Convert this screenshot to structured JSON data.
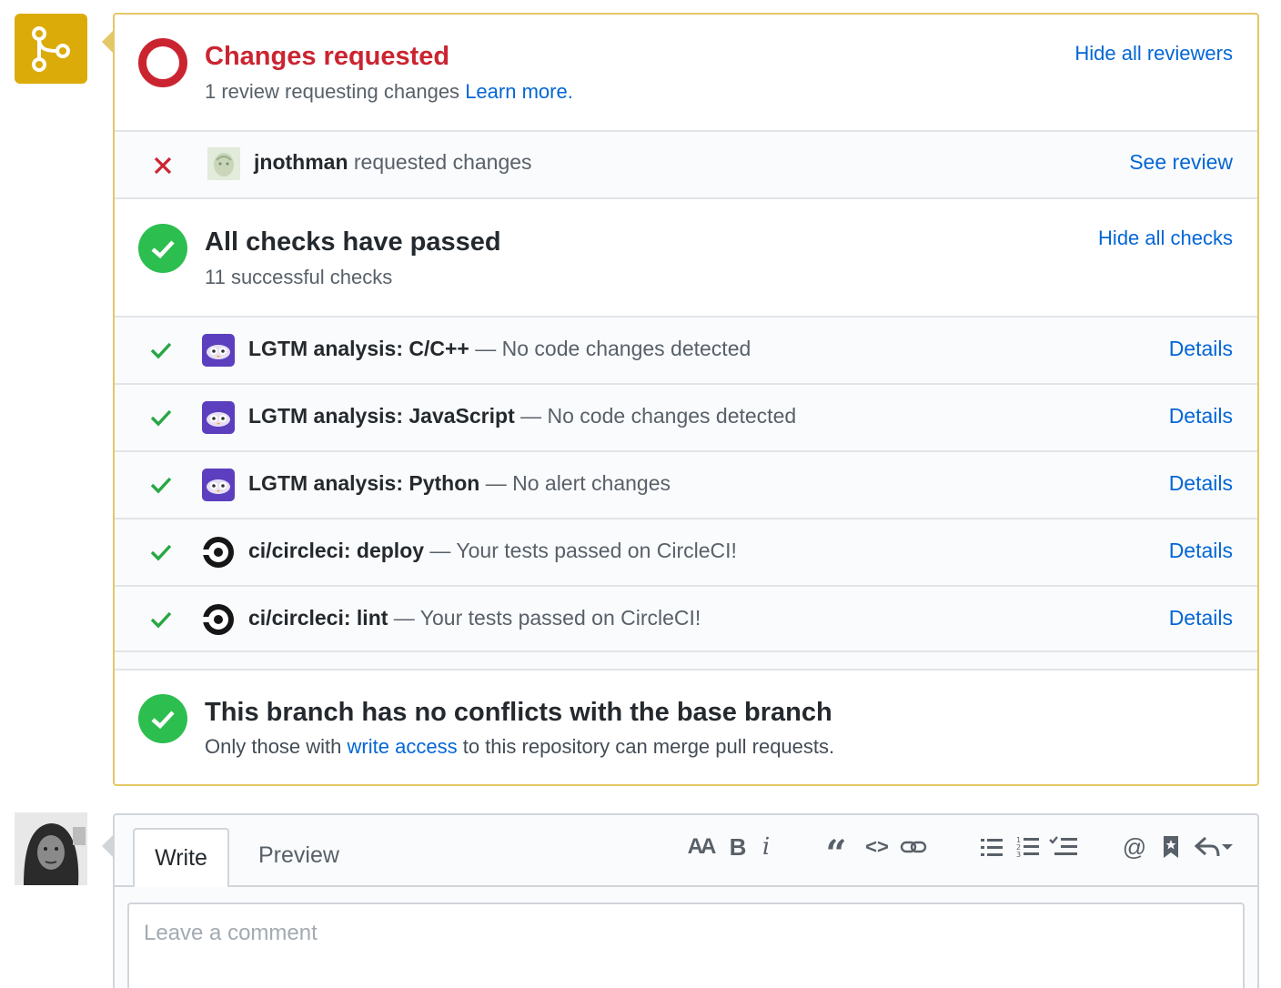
{
  "merge_icon": "git-merge-icon",
  "reviews": {
    "title": "Changes requested",
    "subtitle": "1 review requesting changes",
    "learn_more": "Learn more.",
    "toggle": "Hide all reviewers",
    "status_color": "#cb2431",
    "items": [
      {
        "user": "jnothman",
        "action": "requested changes",
        "link": "See review"
      }
    ]
  },
  "checks": {
    "title": "All checks have passed",
    "subtitle": "11 successful checks",
    "toggle": "Hide all checks",
    "status_color": "#2cbe4e",
    "items": [
      {
        "name": "LGTM analysis: C/C++",
        "desc": "— No code changes detected",
        "link": "Details",
        "logo": "lgtm-logo-icon"
      },
      {
        "name": "LGTM analysis: JavaScript",
        "desc": "— No code changes detected",
        "link": "Details",
        "logo": "lgtm-logo-icon"
      },
      {
        "name": "LGTM analysis: Python",
        "desc": "— No alert changes",
        "link": "Details",
        "logo": "lgtm-logo-icon"
      },
      {
        "name": "ci/circleci: deploy",
        "desc": "— Your tests passed on CircleCI!",
        "link": "Details",
        "logo": "circleci-logo-icon"
      },
      {
        "name": "ci/circleci: lint",
        "desc": "— Your tests passed on CircleCI!",
        "link": "Details",
        "logo": "circleci-logo-icon"
      }
    ]
  },
  "merge": {
    "title": "This branch has no conflicts with the base branch",
    "subtitle_pre": "Only those with",
    "subtitle_link": "write access",
    "subtitle_post": "to this repository can merge pull requests."
  },
  "comment": {
    "tabs": {
      "write": "Write",
      "preview": "Preview"
    },
    "toolbar": {
      "header": "AA",
      "bold": "B",
      "italic": "i",
      "quote": "“",
      "code": "<>",
      "mention": "@"
    },
    "placeholder": "Leave a comment"
  },
  "colors": {
    "link": "#0366d6",
    "merge_avatar_bg": "#dbab0a",
    "box_border": "#e3c866"
  }
}
